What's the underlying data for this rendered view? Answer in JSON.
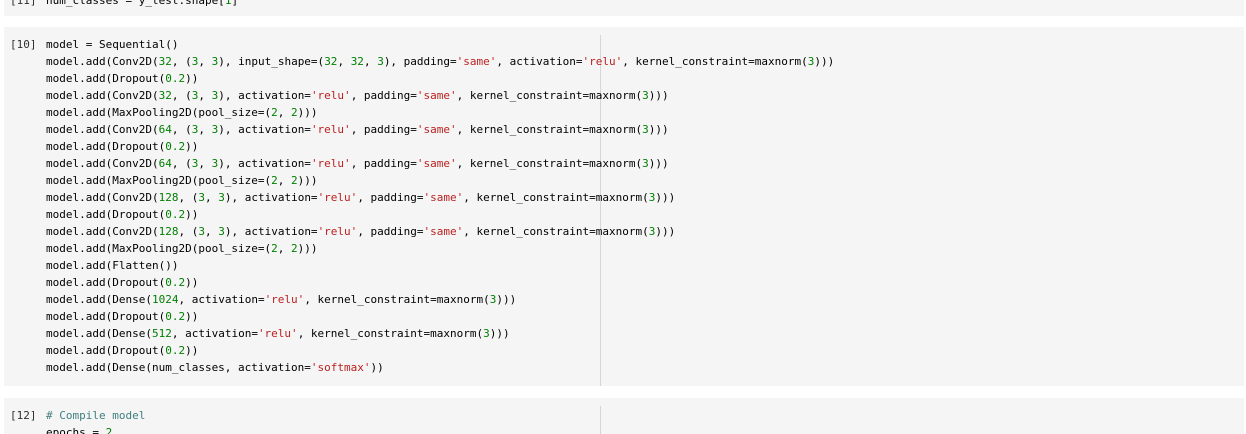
{
  "cells": [
    {
      "id": "cell-11",
      "prompt": "[11]",
      "lines": [
        [
          {
            "t": "num_classes = y_test.shape[",
            "k": "txt"
          },
          {
            "t": "1",
            "k": "num"
          },
          {
            "t": "]",
            "k": "txt"
          }
        ]
      ]
    },
    {
      "id": "cell-10",
      "prompt": "[10]",
      "lines": [
        [
          {
            "t": "model = Sequential()",
            "k": "txt"
          }
        ],
        [
          {
            "t": "model.add(Conv2D(",
            "k": "txt"
          },
          {
            "t": "32",
            "k": "num"
          },
          {
            "t": ", (",
            "k": "txt"
          },
          {
            "t": "3",
            "k": "num"
          },
          {
            "t": ", ",
            "k": "txt"
          },
          {
            "t": "3",
            "k": "num"
          },
          {
            "t": "), input_shape=(",
            "k": "txt"
          },
          {
            "t": "32",
            "k": "num"
          },
          {
            "t": ", ",
            "k": "txt"
          },
          {
            "t": "32",
            "k": "num"
          },
          {
            "t": ", ",
            "k": "txt"
          },
          {
            "t": "3",
            "k": "num"
          },
          {
            "t": "), padding=",
            "k": "txt"
          },
          {
            "t": "'same'",
            "k": "str"
          },
          {
            "t": ", activation=",
            "k": "txt"
          },
          {
            "t": "'relu'",
            "k": "str"
          },
          {
            "t": ", kernel_constraint=maxnorm(",
            "k": "txt"
          },
          {
            "t": "3",
            "k": "num"
          },
          {
            "t": ")))",
            "k": "txt"
          }
        ],
        [
          {
            "t": "model.add(Dropout(",
            "k": "txt"
          },
          {
            "t": "0.2",
            "k": "num"
          },
          {
            "t": "))",
            "k": "txt"
          }
        ],
        [
          {
            "t": "model.add(Conv2D(",
            "k": "txt"
          },
          {
            "t": "32",
            "k": "num"
          },
          {
            "t": ", (",
            "k": "txt"
          },
          {
            "t": "3",
            "k": "num"
          },
          {
            "t": ", ",
            "k": "txt"
          },
          {
            "t": "3",
            "k": "num"
          },
          {
            "t": "), activation=",
            "k": "txt"
          },
          {
            "t": "'relu'",
            "k": "str"
          },
          {
            "t": ", padding=",
            "k": "txt"
          },
          {
            "t": "'same'",
            "k": "str"
          },
          {
            "t": ", kernel_constraint=maxnorm(",
            "k": "txt"
          },
          {
            "t": "3",
            "k": "num"
          },
          {
            "t": ")))",
            "k": "txt"
          }
        ],
        [
          {
            "t": "model.add(MaxPooling2D(pool_size=(",
            "k": "txt"
          },
          {
            "t": "2",
            "k": "num"
          },
          {
            "t": ", ",
            "k": "txt"
          },
          {
            "t": "2",
            "k": "num"
          },
          {
            "t": ")))",
            "k": "txt"
          }
        ],
        [
          {
            "t": "model.add(Conv2D(",
            "k": "txt"
          },
          {
            "t": "64",
            "k": "num"
          },
          {
            "t": ", (",
            "k": "txt"
          },
          {
            "t": "3",
            "k": "num"
          },
          {
            "t": ", ",
            "k": "txt"
          },
          {
            "t": "3",
            "k": "num"
          },
          {
            "t": "), activation=",
            "k": "txt"
          },
          {
            "t": "'relu'",
            "k": "str"
          },
          {
            "t": ", padding=",
            "k": "txt"
          },
          {
            "t": "'same'",
            "k": "str"
          },
          {
            "t": ", kernel_constraint=maxnorm(",
            "k": "txt"
          },
          {
            "t": "3",
            "k": "num"
          },
          {
            "t": ")))",
            "k": "txt"
          }
        ],
        [
          {
            "t": "model.add(Dropout(",
            "k": "txt"
          },
          {
            "t": "0.2",
            "k": "num"
          },
          {
            "t": "))",
            "k": "txt"
          }
        ],
        [
          {
            "t": "model.add(Conv2D(",
            "k": "txt"
          },
          {
            "t": "64",
            "k": "num"
          },
          {
            "t": ", (",
            "k": "txt"
          },
          {
            "t": "3",
            "k": "num"
          },
          {
            "t": ", ",
            "k": "txt"
          },
          {
            "t": "3",
            "k": "num"
          },
          {
            "t": "), activation=",
            "k": "txt"
          },
          {
            "t": "'relu'",
            "k": "str"
          },
          {
            "t": ", padding=",
            "k": "txt"
          },
          {
            "t": "'same'",
            "k": "str"
          },
          {
            "t": ", kernel_constraint=maxnorm(",
            "k": "txt"
          },
          {
            "t": "3",
            "k": "num"
          },
          {
            "t": ")))",
            "k": "txt"
          }
        ],
        [
          {
            "t": "model.add(MaxPooling2D(pool_size=(",
            "k": "txt"
          },
          {
            "t": "2",
            "k": "num"
          },
          {
            "t": ", ",
            "k": "txt"
          },
          {
            "t": "2",
            "k": "num"
          },
          {
            "t": ")))",
            "k": "txt"
          }
        ],
        [
          {
            "t": "model.add(Conv2D(",
            "k": "txt"
          },
          {
            "t": "128",
            "k": "num"
          },
          {
            "t": ", (",
            "k": "txt"
          },
          {
            "t": "3",
            "k": "num"
          },
          {
            "t": ", ",
            "k": "txt"
          },
          {
            "t": "3",
            "k": "num"
          },
          {
            "t": "), activation=",
            "k": "txt"
          },
          {
            "t": "'relu'",
            "k": "str"
          },
          {
            "t": ", padding=",
            "k": "txt"
          },
          {
            "t": "'same'",
            "k": "str"
          },
          {
            "t": ", kernel_constraint=maxnorm(",
            "k": "txt"
          },
          {
            "t": "3",
            "k": "num"
          },
          {
            "t": ")))",
            "k": "txt"
          }
        ],
        [
          {
            "t": "model.add(Dropout(",
            "k": "txt"
          },
          {
            "t": "0.2",
            "k": "num"
          },
          {
            "t": "))",
            "k": "txt"
          }
        ],
        [
          {
            "t": "model.add(Conv2D(",
            "k": "txt"
          },
          {
            "t": "128",
            "k": "num"
          },
          {
            "t": ", (",
            "k": "txt"
          },
          {
            "t": "3",
            "k": "num"
          },
          {
            "t": ", ",
            "k": "txt"
          },
          {
            "t": "3",
            "k": "num"
          },
          {
            "t": "), activation=",
            "k": "txt"
          },
          {
            "t": "'relu'",
            "k": "str"
          },
          {
            "t": ", padding=",
            "k": "txt"
          },
          {
            "t": "'same'",
            "k": "str"
          },
          {
            "t": ", kernel_constraint=maxnorm(",
            "k": "txt"
          },
          {
            "t": "3",
            "k": "num"
          },
          {
            "t": ")))",
            "k": "txt"
          }
        ],
        [
          {
            "t": "model.add(MaxPooling2D(pool_size=(",
            "k": "txt"
          },
          {
            "t": "2",
            "k": "num"
          },
          {
            "t": ", ",
            "k": "txt"
          },
          {
            "t": "2",
            "k": "num"
          },
          {
            "t": ")))",
            "k": "txt"
          }
        ],
        [
          {
            "t": "model.add(Flatten())",
            "k": "txt"
          }
        ],
        [
          {
            "t": "model.add(Dropout(",
            "k": "txt"
          },
          {
            "t": "0.2",
            "k": "num"
          },
          {
            "t": "))",
            "k": "txt"
          }
        ],
        [
          {
            "t": "model.add(Dense(",
            "k": "txt"
          },
          {
            "t": "1024",
            "k": "num"
          },
          {
            "t": ", activation=",
            "k": "txt"
          },
          {
            "t": "'relu'",
            "k": "str"
          },
          {
            "t": ", kernel_constraint=maxnorm(",
            "k": "txt"
          },
          {
            "t": "3",
            "k": "num"
          },
          {
            "t": ")))",
            "k": "txt"
          }
        ],
        [
          {
            "t": "model.add(Dropout(",
            "k": "txt"
          },
          {
            "t": "0.2",
            "k": "num"
          },
          {
            "t": "))",
            "k": "txt"
          }
        ],
        [
          {
            "t": "model.add(Dense(",
            "k": "txt"
          },
          {
            "t": "512",
            "k": "num"
          },
          {
            "t": ", activation=",
            "k": "txt"
          },
          {
            "t": "'relu'",
            "k": "str"
          },
          {
            "t": ", kernel_constraint=maxnorm(",
            "k": "txt"
          },
          {
            "t": "3",
            "k": "num"
          },
          {
            "t": ")))",
            "k": "txt"
          }
        ],
        [
          {
            "t": "model.add(Dropout(",
            "k": "txt"
          },
          {
            "t": "0.2",
            "k": "num"
          },
          {
            "t": "))",
            "k": "txt"
          }
        ],
        [
          {
            "t": "model.add(Dense(num_classes, activation=",
            "k": "txt"
          },
          {
            "t": "'softmax'",
            "k": "str"
          },
          {
            "t": "))",
            "k": "txt"
          }
        ]
      ]
    },
    {
      "id": "cell-12",
      "prompt": "[12]",
      "lines": [
        [
          {
            "t": "# Compile model",
            "k": "com"
          }
        ],
        [
          {
            "t": "epochs = ",
            "k": "txt"
          },
          {
            "t": "2",
            "k": "num"
          }
        ]
      ]
    }
  ],
  "colors": {
    "cell_background": "#f5f5f5",
    "string": "#ba2121",
    "number": "#008000",
    "comment": "#408080",
    "ruler": "#d6d6d6"
  }
}
